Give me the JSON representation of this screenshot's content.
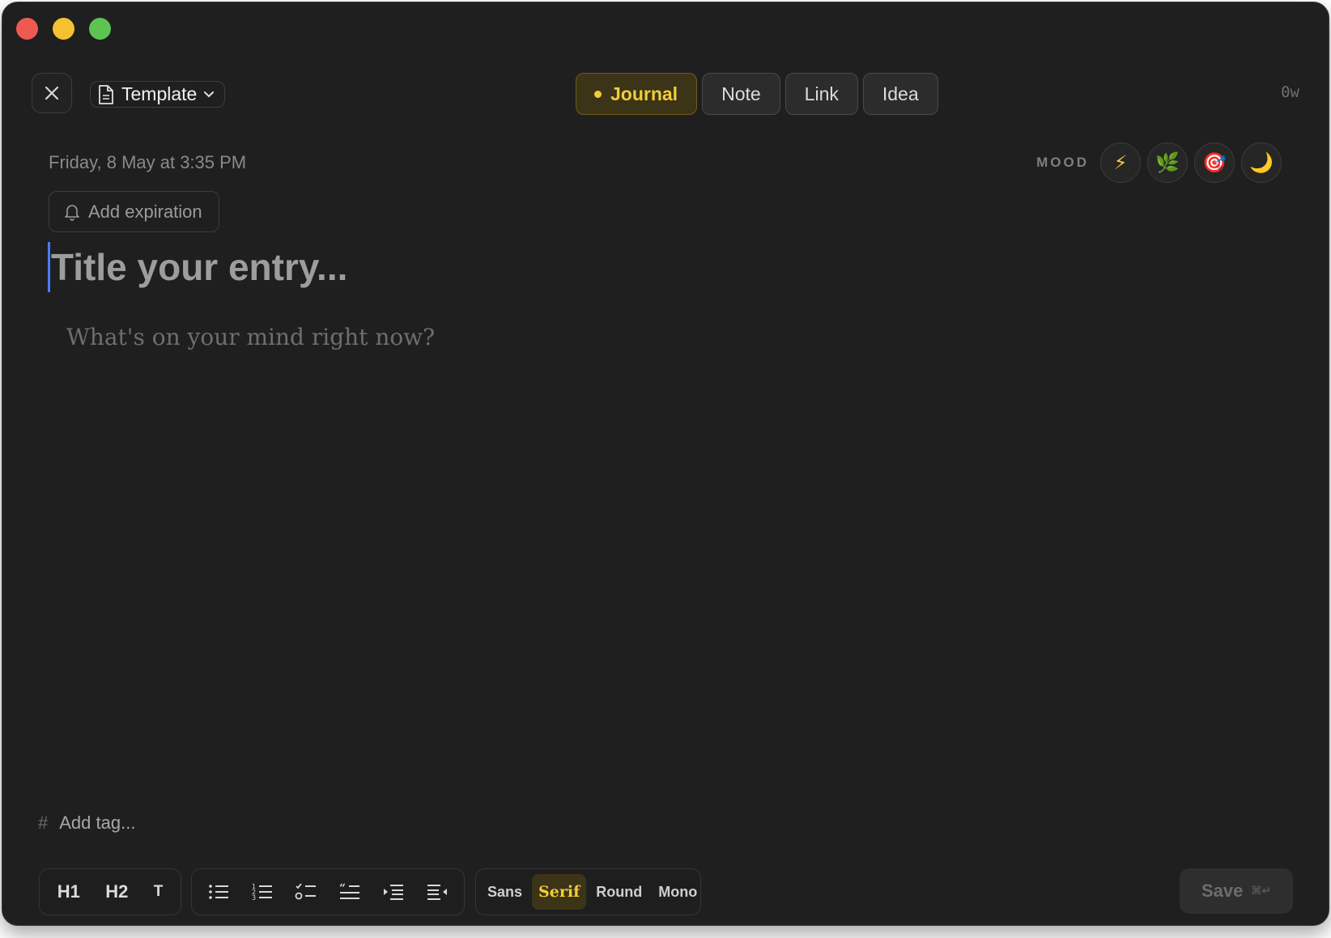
{
  "window": {
    "traffic_lights": [
      "close",
      "minimize",
      "maximize"
    ]
  },
  "header": {
    "close_icon": "close-icon",
    "template_label": "Template",
    "template_icon": "document-icon",
    "types": [
      {
        "label": "Journal",
        "active": true
      },
      {
        "label": "Note",
        "active": false
      },
      {
        "label": "Link",
        "active": false
      },
      {
        "label": "Idea",
        "active": false
      }
    ],
    "word_count": "0w"
  },
  "meta": {
    "date": "Friday, 8 May at 3:35 PM",
    "mood_label": "MOOD",
    "moods": [
      {
        "icon": "lightning-icon",
        "glyph": "⚡"
      },
      {
        "icon": "leaf-icon",
        "glyph": "🌿"
      },
      {
        "icon": "target-icon",
        "glyph": "🎯"
      },
      {
        "icon": "moon-icon",
        "glyph": "🌙"
      }
    ],
    "expiration_label": "Add expiration"
  },
  "editor": {
    "title_placeholder": "Title your entry...",
    "body_placeholder": "What's on your mind right now?"
  },
  "tags": {
    "hash": "#",
    "placeholder": "Add tag..."
  },
  "toolbar": {
    "headings": [
      "H1",
      "H2",
      "T"
    ],
    "lists": [
      "bullet-list-icon",
      "numbered-list-icon",
      "checklist-icon",
      "quote-icon",
      "indent-icon",
      "outdent-icon"
    ],
    "fonts": [
      {
        "label": "Sans",
        "active": false
      },
      {
        "label": "Serif",
        "active": true
      },
      {
        "label": "Round",
        "active": false
      },
      {
        "label": "Mono",
        "active": false
      }
    ],
    "save_label": "Save",
    "save_shortcut": "⌘↵"
  },
  "colors": {
    "accent": "#f2cc3b",
    "background": "#1f1f1f",
    "cursor": "#4a7cff"
  }
}
